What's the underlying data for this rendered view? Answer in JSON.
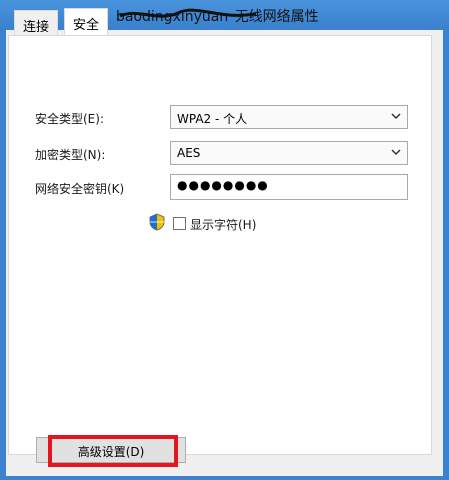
{
  "window": {
    "title": "无线网络属性",
    "title_redacted_name": "baodingxinyuan"
  },
  "tabs": [
    {
      "label": "连接",
      "active": false
    },
    {
      "label": "安全",
      "active": true
    }
  ],
  "form": {
    "security_type": {
      "label": "安全类型(E):",
      "value": "WPA2 - 个人"
    },
    "encryption_type": {
      "label": "加密类型(N):",
      "value": "AES"
    },
    "network_key": {
      "label": "网络安全密钥(K)",
      "value": "●●●●●●●●"
    },
    "show_chars": {
      "label": "显示字符(H)",
      "checked": false
    }
  },
  "buttons": {
    "advanced": "高级设置(D)"
  },
  "colors": {
    "titlebar": "#3b82d0",
    "highlight": "#e5151f"
  }
}
